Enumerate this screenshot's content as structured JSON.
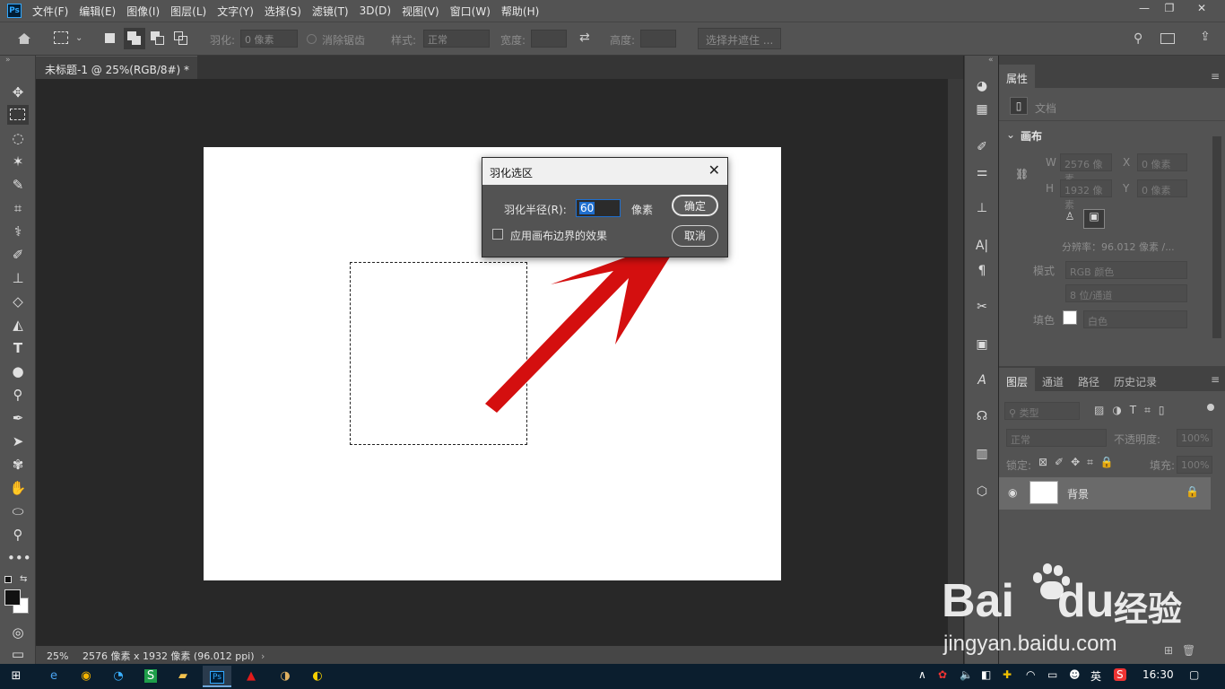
{
  "app": {
    "logo": "Ps"
  },
  "menu": [
    "文件(F)",
    "编辑(E)",
    "图像(I)",
    "图层(L)",
    "文字(Y)",
    "选择(S)",
    "滤镜(T)",
    "3D(D)",
    "视图(V)",
    "窗口(W)",
    "帮助(H)"
  ],
  "options": {
    "feather_label": "羽化:",
    "feather_value": "0 像素",
    "antialias_label": "消除锯齿",
    "style_label": "样式:",
    "style_value": "正常",
    "width_label": "宽度:",
    "height_label": "高度:",
    "select_mask_button": "选择并遮住 ..."
  },
  "document": {
    "tab_title": "未标题-1 @ 25%(RGB/8#) *",
    "tab_close": "×"
  },
  "status": {
    "zoom": "25%",
    "info": "2576 像素 x 1932 像素 (96.012 ppi)"
  },
  "dialog": {
    "title": "羽化选区",
    "close": "✕",
    "radius_label": "羽化半径(R):",
    "radius_value": "60",
    "unit": "像素",
    "ok_button": "确定",
    "cancel_button": "取消",
    "checkbox_label": "应用画布边界的效果"
  },
  "properties": {
    "tab": "属性",
    "doc_label": "文档",
    "canvas_section": "画布",
    "w_label": "W",
    "w_value": "2576 像素",
    "h_label": "H",
    "h_value": "1932 像素",
    "x_label": "X",
    "x_value": "0 像素",
    "y_label": "Y",
    "y_value": "0 像素",
    "resolution": "分辨率：96.012 像素 /...",
    "mode_label": "模式",
    "mode_value": "RGB 颜色",
    "depth_value": "8 位/通道",
    "fill_label": "填色",
    "fill_value": "白色"
  },
  "layers": {
    "tabs": [
      "图层",
      "通道",
      "路径",
      "历史记录"
    ],
    "filter_label": "类型",
    "blend_mode": "正常",
    "opacity_label": "不透明度:",
    "opacity_value": "100%",
    "lock_label": "锁定:",
    "fill_label": "填充:",
    "fill_value": "100%",
    "layer_name": "背景"
  },
  "taskbar": {
    "ime": "英",
    "time": "16:30"
  },
  "watermark": {
    "brand": "Bai",
    "brand2": "du",
    "cn": "经验",
    "url": "jingyan.baidu.com"
  }
}
